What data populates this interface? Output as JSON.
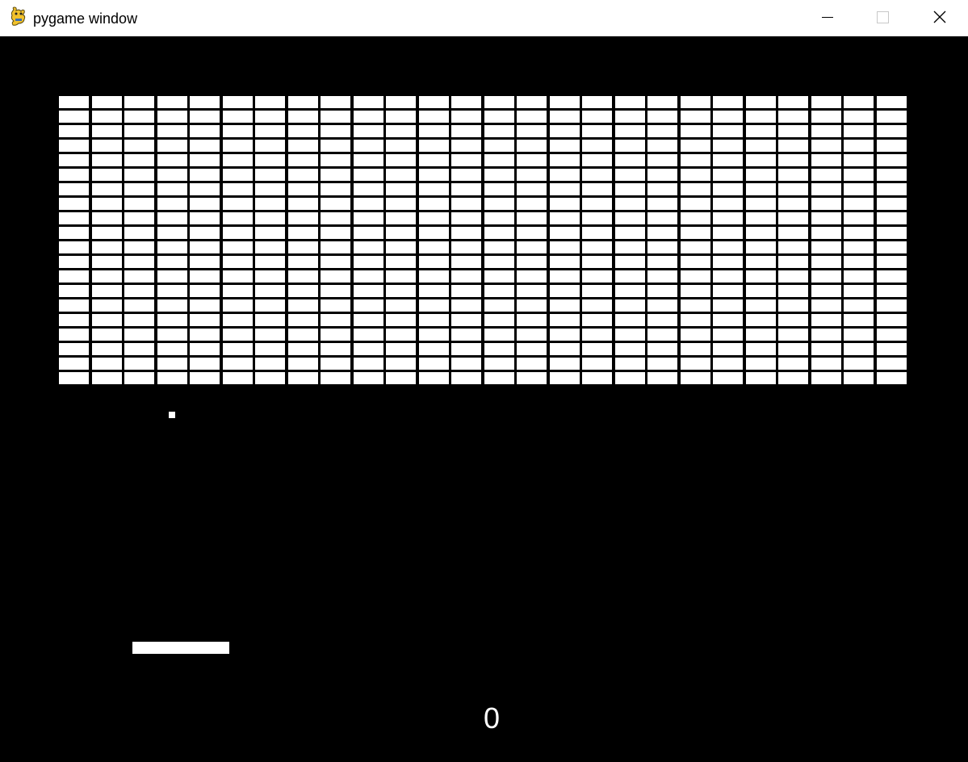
{
  "window": {
    "title": "pygame window",
    "icon": "pygame-snake-icon",
    "controls": {
      "minimize_icon": "minimize-icon",
      "maximize_icon": "maximize-icon",
      "close_icon": "close-icon"
    }
  },
  "game": {
    "background_color": "#000000",
    "foreground_color": "#ffffff",
    "bricks": {
      "rows": 20,
      "columns": 26,
      "remaining": 520
    },
    "score": "0"
  }
}
